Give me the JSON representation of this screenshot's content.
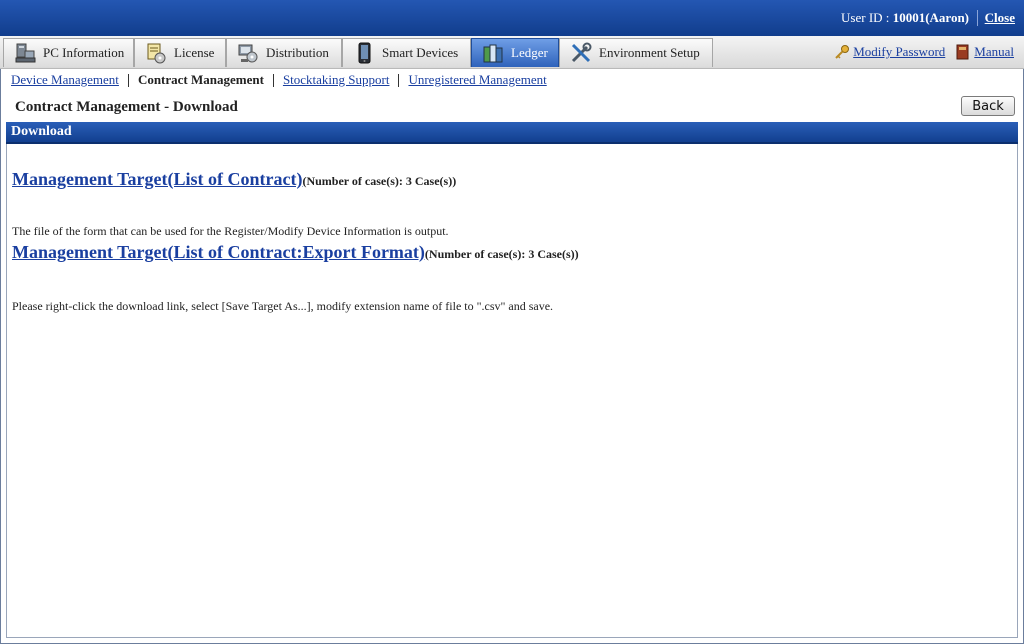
{
  "header": {
    "user_label": "User ID : ",
    "user_value": "10001(Aaron)",
    "close_label": "Close"
  },
  "tabs": [
    {
      "label": "PC Information",
      "icon": "pc-icon"
    },
    {
      "label": "License",
      "icon": "license-icon"
    },
    {
      "label": "Distribution",
      "icon": "distribution-icon"
    },
    {
      "label": "Smart Devices",
      "icon": "smartphone-icon"
    },
    {
      "label": "Ledger",
      "icon": "ledger-icon",
      "active": true
    },
    {
      "label": "Environment Setup",
      "icon": "tools-icon"
    }
  ],
  "right_links": {
    "modify_password": "Modify Password",
    "manual": "Manual"
  },
  "subnav": {
    "device_management": "Device Management",
    "contract_management": "Contract Management",
    "stocktaking_support": "Stocktaking Support",
    "unregistered_management": "Unregistered Management"
  },
  "page": {
    "title": "Contract Management - Download",
    "back_label": "Back",
    "section_title": "Download"
  },
  "downloads": [
    {
      "link": "Management Target(List of Contract)",
      "count": "(Number of case(s): 3 Case(s))"
    },
    {
      "link": "Management Target(List of Contract:Export Format)",
      "count": "(Number of case(s): 3 Case(s))"
    }
  ],
  "notes": {
    "form_note": "The file of the form that can be used for the Register/Modify Device Information is output.",
    "save_note": "Please right-click the download link, select [Save Target As...], modify extension name of file to \".csv\" and save."
  },
  "colors": {
    "header_blue": "#1a4aa0",
    "link_blue": "#1a3fa0",
    "active_tab": "#3a6fc4"
  }
}
